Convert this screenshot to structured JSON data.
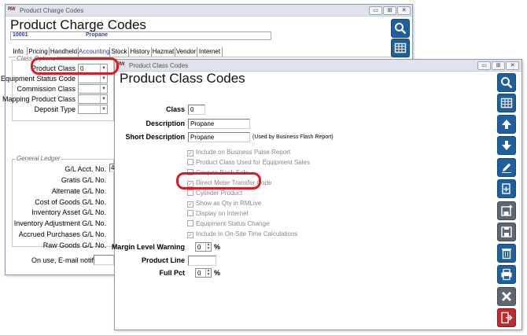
{
  "back_window": {
    "title": "Product Charge Codes",
    "heading": "Product Charge Codes",
    "code": "10001",
    "name": "Propane",
    "tabs": [
      "Info",
      "Pricing",
      "Handheld",
      "Accounting",
      "Stock",
      "History",
      "Hazmat",
      "Vendor",
      "Internet"
    ],
    "active_tab": "Accounting",
    "class_options_label": "Class Options",
    "class_fields": [
      {
        "label": "Product Class",
        "value": "0"
      },
      {
        "label": "Equipment Status Code",
        "value": ""
      },
      {
        "label": "Commission Class",
        "value": ""
      },
      {
        "label": "Mapping Product Class",
        "value": ""
      },
      {
        "label": "Deposit Type",
        "value": ""
      }
    ],
    "general_ledger_label": "General Ledger",
    "gl_fields": [
      {
        "label": "G/L Acct. No.",
        "value": "4"
      },
      {
        "label": "Gratis G/L No.",
        "value": ""
      },
      {
        "label": "Alternate G/L No.",
        "value": ""
      },
      {
        "label": "Cost of Goods G/L No.",
        "value": ""
      },
      {
        "label": "Inventory Asset G/L No.",
        "value": ""
      },
      {
        "label": "Inventory Adjustment G/L No.",
        "value": ""
      },
      {
        "label": "Accrued Purchases G/L No.",
        "value": ""
      },
      {
        "label": "Raw Goods G/L No.",
        "value": ""
      }
    ],
    "email_label": "On use, E-mail notification"
  },
  "front_window": {
    "title": "Product Class Codes",
    "heading": "Product Class Codes",
    "class_label": "Class",
    "class_value": "0",
    "description_label": "Description",
    "description_value": "Propane",
    "short_description_label": "Short Description",
    "short_description_value": "Propane",
    "short_description_note": "(Used by Business Flash Report)",
    "checkboxes": [
      {
        "label": "Include on Business Pulse Report",
        "checked": true
      },
      {
        "label": "Product Class Used for Equipment Sales",
        "checked": false
      },
      {
        "label": "Coupon Book Sale",
        "checked": false
      },
      {
        "label": "Direct Meter Transfer Code",
        "checked": true
      },
      {
        "label": "Cylinder Product",
        "checked": false
      },
      {
        "label": "Show as Qty in RMLive",
        "checked": true
      },
      {
        "label": "Display on Internet",
        "checked": false
      },
      {
        "label": "Equipment Status Change",
        "checked": false
      },
      {
        "label": "Include In On-Site Time Calculations",
        "checked": true
      }
    ],
    "margin_level_label": "Margin Level Warning",
    "margin_level_value": "0",
    "product_line_label": "Product Line",
    "full_pct_label": "Full Pct",
    "full_pct_value": "0",
    "percent_sign": "%"
  },
  "toolbar_icons": [
    "search-icon",
    "grid-icon",
    "arrow-up-icon",
    "arrow-down-icon",
    "edit-icon",
    "copy-icon",
    "save-new-icon",
    "save-icon",
    "delete-icon",
    "print-icon",
    "cancel-icon",
    "exit-icon"
  ],
  "colors": {
    "accent_blue": "#1f5f9e",
    "highlight_red": "#e01820",
    "active_tab": "#2d3fb0"
  }
}
